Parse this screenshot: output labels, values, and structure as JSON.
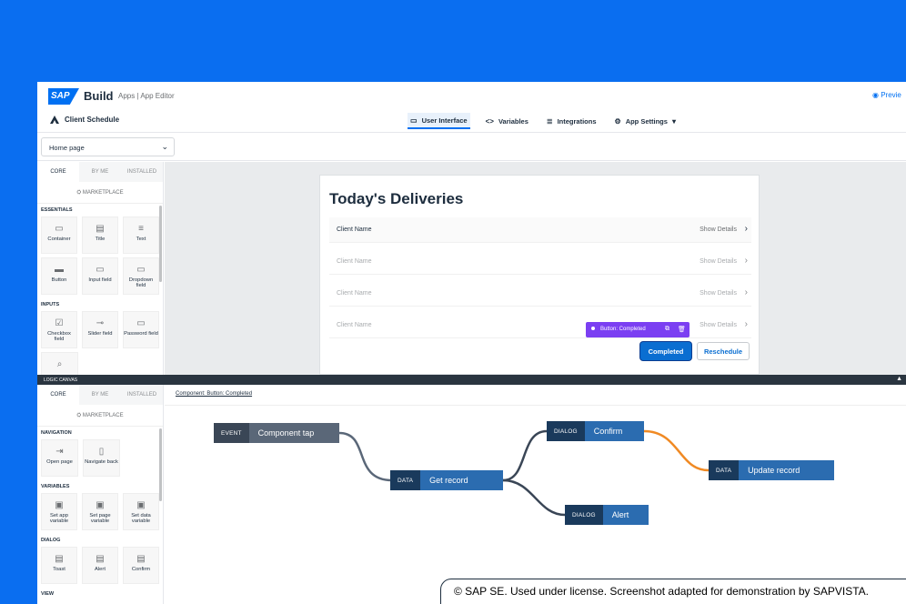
{
  "header": {
    "brand_logo": "SAP",
    "brand": "Build",
    "breadcrumb": "Apps  |  App Editor",
    "preview_label": "Previe",
    "app_name": "Client Schedule",
    "nav": [
      {
        "label": "User Interface",
        "icon": "monitor-icon",
        "active": true
      },
      {
        "label": "Variables",
        "icon": "code-icon",
        "active": false
      },
      {
        "label": "Integrations",
        "icon": "database-icon",
        "active": false
      },
      {
        "label": "App Settings",
        "icon": "gear-icon",
        "active": false
      }
    ]
  },
  "page_selector": {
    "value": "Home page"
  },
  "ui_panel": {
    "tabs": [
      "CORE",
      "BY ME",
      "INSTALLED"
    ],
    "marketplace": "MARKETPLACE",
    "sections": [
      {
        "title": "ESSENTIALS",
        "items": [
          "Container",
          "Title",
          "Text",
          "Button",
          "Input field",
          "Dropdown field"
        ]
      },
      {
        "title": "INPUTS",
        "items": [
          "Checkbox field",
          "Slider field",
          "Password field"
        ]
      }
    ]
  },
  "canvas": {
    "title": "Today's Deliveries",
    "rows": [
      {
        "name": "Client Name",
        "action": "Show Details"
      },
      {
        "name": "Client Name",
        "action": "Show Details"
      },
      {
        "name": "Client Name",
        "action": "Show Details"
      },
      {
        "name": "Client Name",
        "action": "Show Details"
      }
    ],
    "selection_tag": "Button: Completed",
    "primary_button": "Completed",
    "secondary_button": "Reschedule"
  },
  "logic_canvas": {
    "bar_label": "LOGIC CANVAS",
    "breadcrumb": "Component: Button: Completed",
    "nodes": [
      {
        "type": "EVENT",
        "label": "Component tap"
      },
      {
        "type": "DATA",
        "label": "Get record"
      },
      {
        "type": "DIALOG",
        "label": "Confirm"
      },
      {
        "type": "DIALOG",
        "label": "Alert"
      },
      {
        "type": "DATA",
        "label": "Update record"
      }
    ]
  },
  "logic_panel": {
    "tabs": [
      "CORE",
      "BY ME",
      "INSTALLED"
    ],
    "marketplace": "MARKETPLACE",
    "sections": [
      {
        "title": "NAVIGATION",
        "items": [
          "Open page",
          "Navigate back"
        ]
      },
      {
        "title": "VARIABLES",
        "items": [
          "Set app variable",
          "Set page variable",
          "Set data variable"
        ]
      },
      {
        "title": "DIALOG",
        "items": [
          "Toast",
          "Alert",
          "Confirm"
        ]
      },
      {
        "title": "VIEW",
        "items": []
      }
    ]
  },
  "credit": "© SAP SE. Used under license. Screenshot adapted for demonstration by SAPVISTA.",
  "colors": {
    "background": "#0a6ef0",
    "accent": "#0070f2",
    "selection": "#7b3ff2",
    "wire_active": "#f08a24"
  }
}
